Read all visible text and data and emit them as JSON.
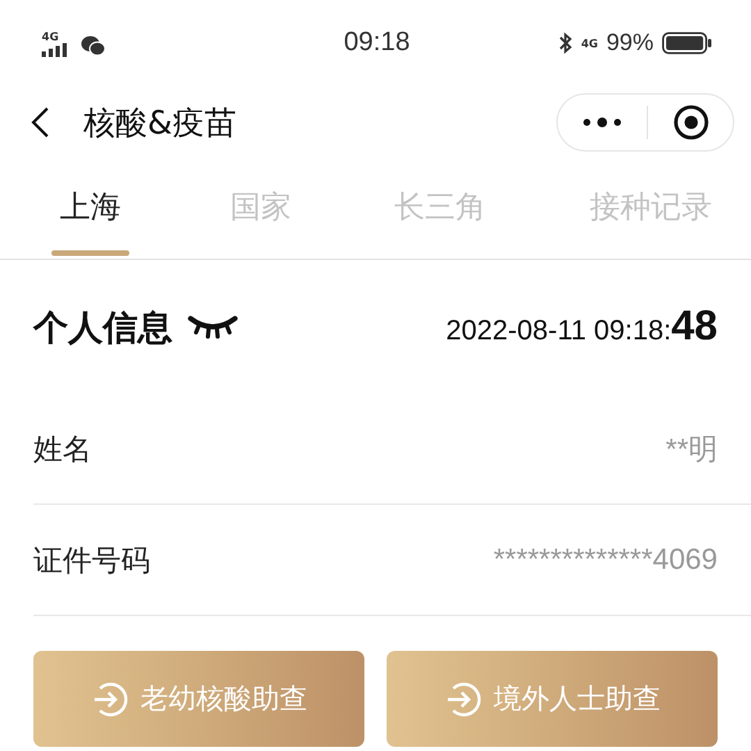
{
  "status_bar": {
    "network": "4G",
    "time": "09:18",
    "cell": "4G",
    "battery": "99%"
  },
  "nav": {
    "title": "核酸&疫苗"
  },
  "tabs": [
    {
      "label": "上海",
      "selected": true
    },
    {
      "label": "国家",
      "selected": false
    },
    {
      "label": "长三角",
      "selected": false
    },
    {
      "label": "接种记录",
      "selected": false
    }
  ],
  "section": {
    "title": "个人信息",
    "timestamp": "2022-08-11 09:18:**48**"
  },
  "fields": [
    {
      "label": "姓名",
      "value": "**明"
    },
    {
      "label": "证件号码",
      "value": "**************4069"
    }
  ],
  "buttons": [
    {
      "label": "老幼核酸助查"
    },
    {
      "label": "境外人士助查"
    }
  ]
}
